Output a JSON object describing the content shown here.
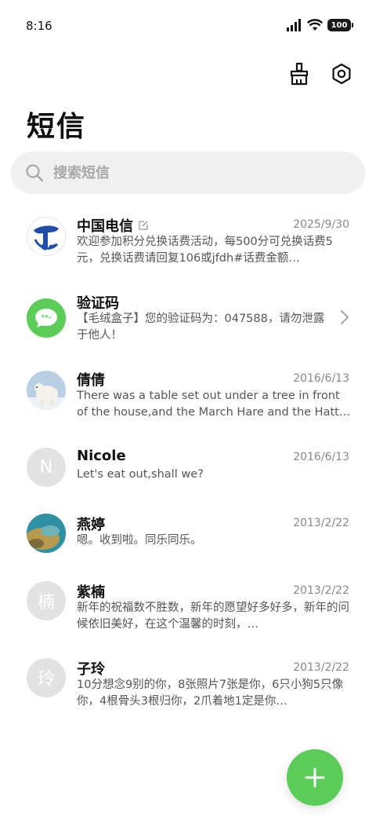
{
  "status": {
    "time": "8:16",
    "battery": "100"
  },
  "header": {
    "title": "短信"
  },
  "search": {
    "placeholder": "搜索短信"
  },
  "conversations": [
    {
      "name": "中国电信",
      "date": "2025/9/30",
      "preview": "欢迎参加积分兑换话费活动，每500分可兑换话费5元，兑换话费请回复106或jfdh#话费金额…"
    },
    {
      "name": "验证码",
      "date": "",
      "preview": "【毛绒盒子】您的验证码为：047588，请勿泄露于他人！"
    },
    {
      "name": "倩倩",
      "date": "2016/6/13",
      "preview": "There was a table set out under a tree in front of the house,and the March Hare and the Hatter we…"
    },
    {
      "name": "Nicole",
      "date": "2016/6/13",
      "preview": "Let's eat out,shall we?",
      "avatar_letter": "N"
    },
    {
      "name": "燕婷",
      "date": "2013/2/22",
      "preview": "嗯。收到啦。同乐同乐。"
    },
    {
      "name": "紫楠",
      "date": "2013/2/22",
      "preview": "新年的祝福数不胜数，新年的愿望好多好多，新年的问候依旧美好，在这个温馨的时刻，…",
      "avatar_letter": "楠"
    },
    {
      "name": "子玲",
      "date": "2013/2/22",
      "preview": "10分想念9别的你，8张照片7张是你，6只小狗5只像你，4根骨头3根归你，2爪着地1定是你…",
      "avatar_letter": "玲"
    }
  ],
  "colors": {
    "accent": "#5bcc57",
    "telecom_blue": "#1f4ea8"
  }
}
